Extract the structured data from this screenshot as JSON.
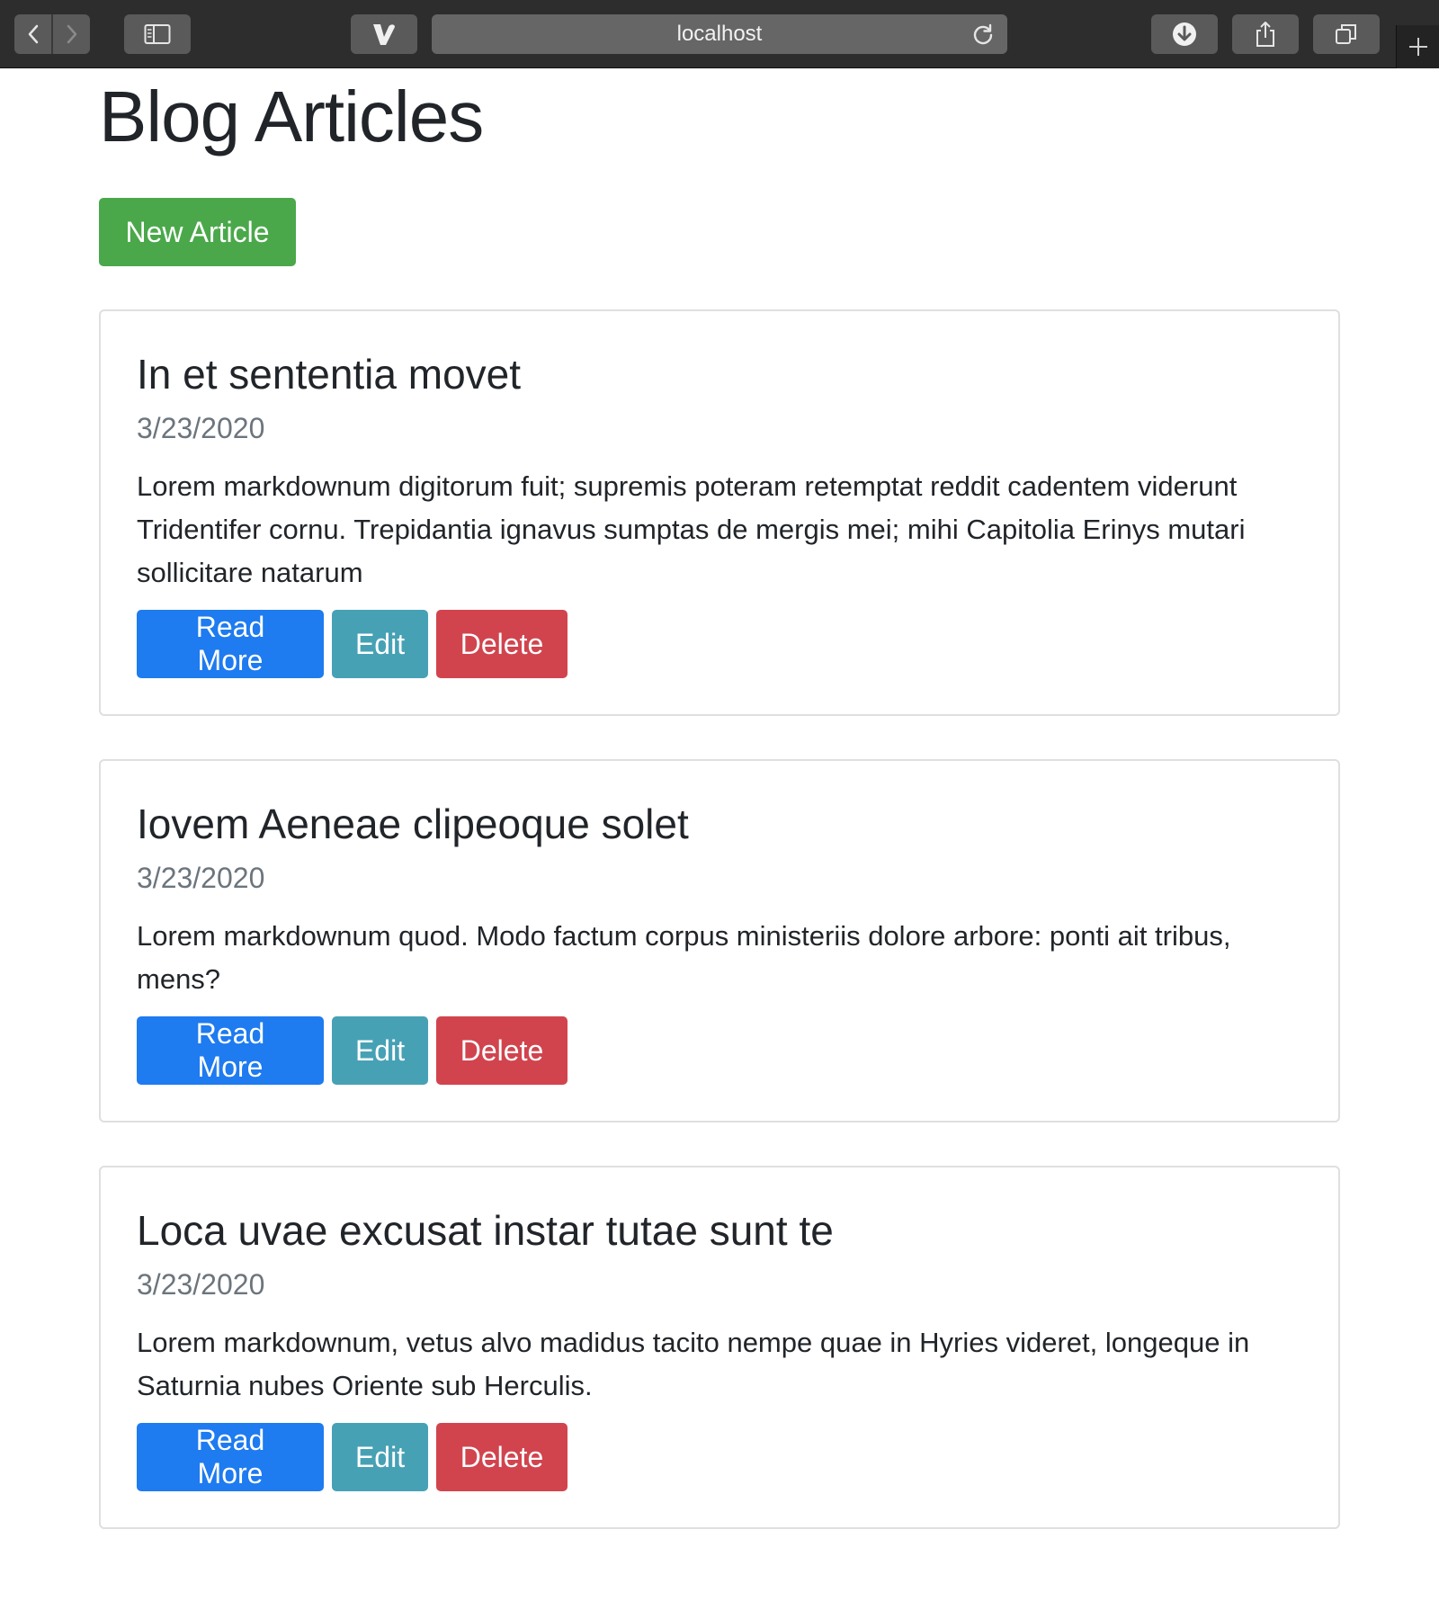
{
  "browser": {
    "url": "localhost"
  },
  "page": {
    "title": "Blog Articles",
    "new_article_label": "New Article",
    "colors": {
      "success": "#4aa84a",
      "primary": "#1e7bf0",
      "info": "#47a1b5",
      "danger": "#d1444e"
    }
  },
  "articles": [
    {
      "title": "In et sententia movet",
      "date": "3/23/2020",
      "excerpt": "Lorem markdownum digitorum fuit; supremis poteram retemptat reddit cadentem viderunt Tridentifer cornu. Trepidantia ignavus sumptas de mergis mei; mihi Capitolia Erinys mutari sollicitare natarum",
      "read_more_label": "Read More",
      "edit_label": "Edit",
      "delete_label": "Delete"
    },
    {
      "title": "Iovem Aeneae clipeoque solet",
      "date": "3/23/2020",
      "excerpt": "Lorem markdownum quod. Modo factum corpus ministeriis dolore arbore: ponti ait tribus, mens?",
      "read_more_label": "Read More",
      "edit_label": "Edit",
      "delete_label": "Delete"
    },
    {
      "title": "Loca uvae excusat instar tutae sunt te",
      "date": "3/23/2020",
      "excerpt": "Lorem markdownum, vetus alvo madidus tacito nempe quae in Hyries videret, longeque in Saturnia nubes Oriente sub Herculis.",
      "read_more_label": "Read More",
      "edit_label": "Edit",
      "delete_label": "Delete"
    }
  ]
}
